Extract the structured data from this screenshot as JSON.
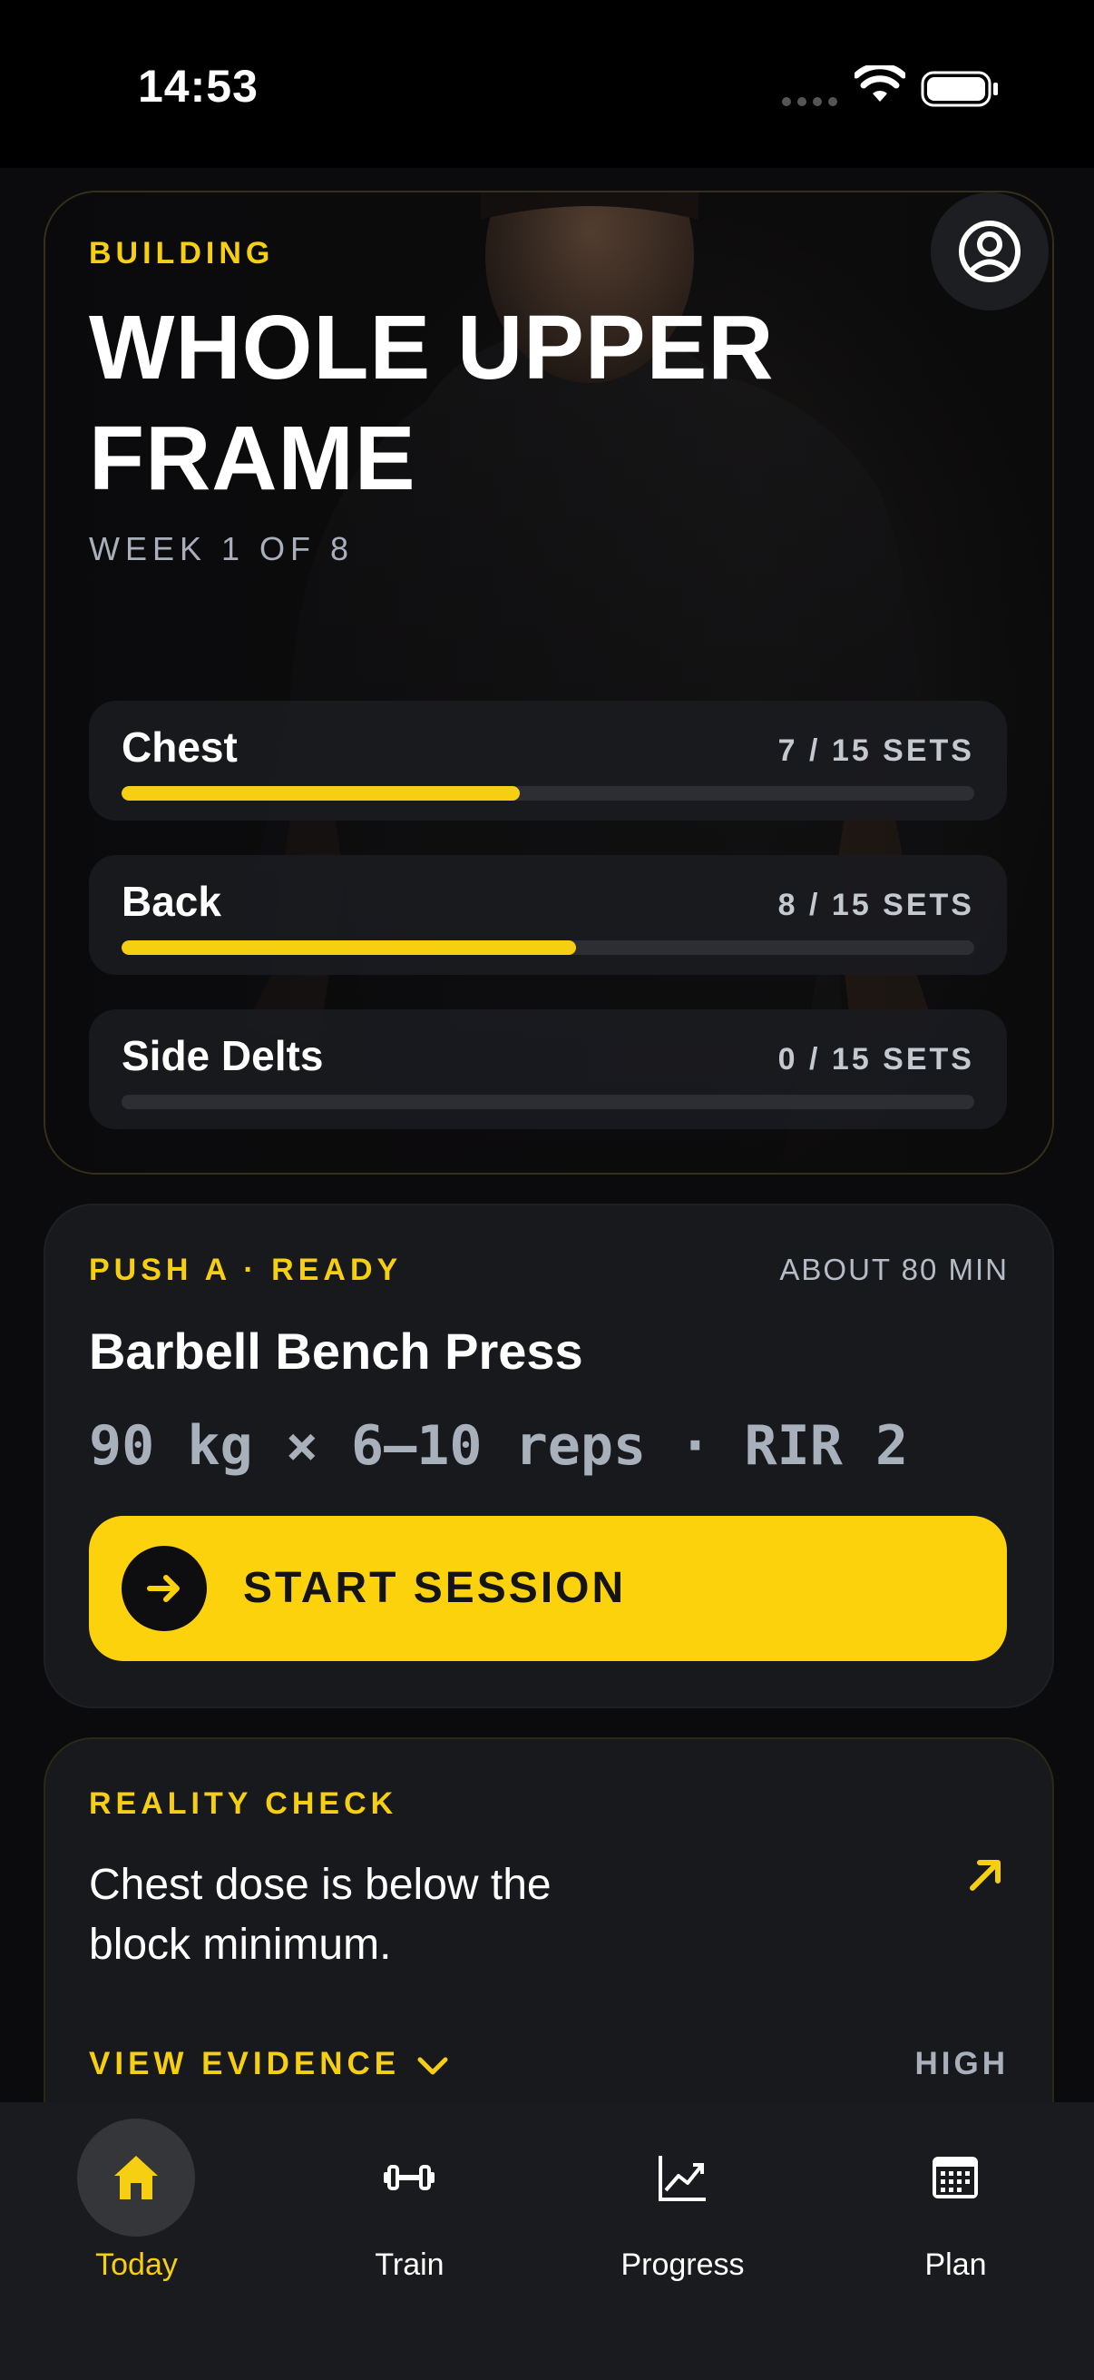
{
  "status_bar": {
    "time": "14:53"
  },
  "hero": {
    "kicker": "BUILDING",
    "title_line1": "WHOLE UPPER",
    "title_line2": "FRAME",
    "week": "WEEK 1 OF 8",
    "muscles": [
      {
        "name": "Chest",
        "sets": "7 / 15 SETS",
        "done": 7,
        "target": 15
      },
      {
        "name": "Back",
        "sets": "8 / 15 SETS",
        "done": 8,
        "target": 15
      },
      {
        "name": "Side Delts",
        "sets": "0 / 15 SETS",
        "done": 0,
        "target": 15
      }
    ]
  },
  "session": {
    "kicker": "PUSH A · READY",
    "duration": "ABOUT 80 MIN",
    "exercise": "Barbell Bench Press",
    "prescription": "90 kg × 6–10 reps · RIR 2",
    "start_label": "START SESSION"
  },
  "reality": {
    "kicker": "REALITY CHECK",
    "message": "Chest dose is below the block minimum.",
    "evidence_label": "VIEW EVIDENCE",
    "severity": "HIGH"
  },
  "tabs": [
    {
      "label": "Today",
      "icon": "home-icon",
      "active": true
    },
    {
      "label": "Train",
      "icon": "dumbbell-icon",
      "active": false
    },
    {
      "label": "Progress",
      "icon": "trend-chart-icon",
      "active": false
    },
    {
      "label": "Plan",
      "icon": "calendar-icon",
      "active": false
    }
  ],
  "colors": {
    "accent": "#fcd20c",
    "background": "#0b0b0d",
    "card": "#18191d"
  }
}
